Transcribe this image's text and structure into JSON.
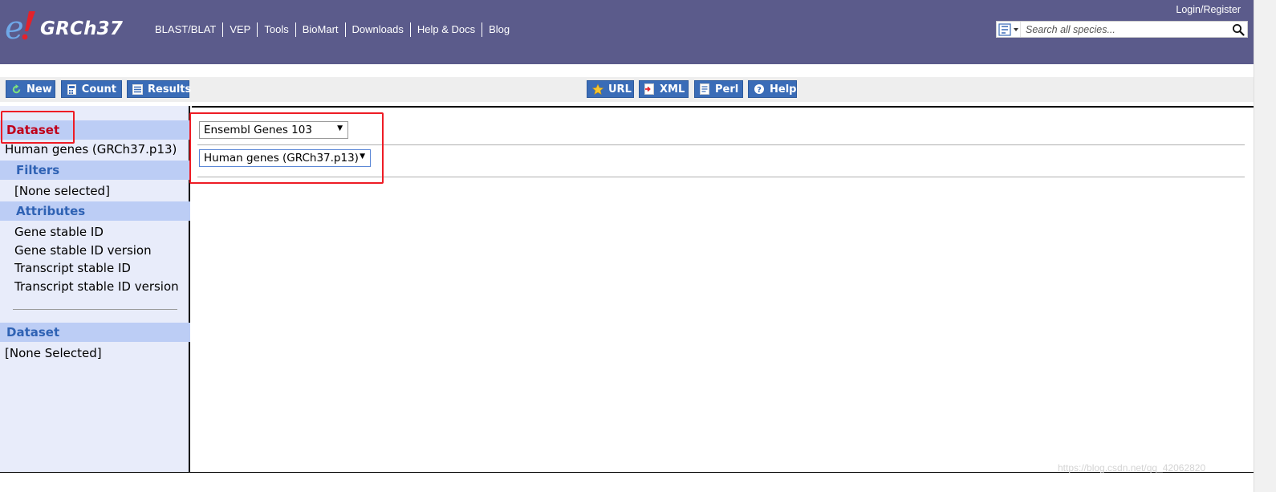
{
  "masthead": {
    "logo_text": "GRCh37",
    "nav": [
      "BLAST/BLAT",
      "VEP",
      "Tools",
      "BioMart",
      "Downloads",
      "Help & Docs",
      "Blog"
    ],
    "login": "Login/Register",
    "search": {
      "placeholder": "Search all species..."
    }
  },
  "toolbar": {
    "new": "New",
    "count": "Count",
    "results": "Results",
    "url": "URL",
    "xml": "XML",
    "perl": "Perl",
    "help": "Help"
  },
  "sidebar": {
    "dataset1": {
      "heading": "Dataset",
      "value": "Human genes (GRCh37.p13)"
    },
    "filters": {
      "heading": "Filters",
      "value": "[None selected]"
    },
    "attributes": {
      "heading": "Attributes",
      "items": [
        "Gene stable ID",
        "Gene stable ID version",
        "Transcript stable ID",
        "Transcript stable ID version"
      ]
    },
    "dataset2": {
      "heading": "Dataset",
      "value": "[None Selected]"
    }
  },
  "main": {
    "database_select": {
      "value": "Ensembl Genes 103"
    },
    "dataset_select": {
      "value": "Human genes (GRCh37.p13)"
    }
  },
  "watermark": "https://blog.csdn.net/qq_42062820",
  "colors": {
    "masthead": "#5b5b8b",
    "toolbar_button": "#3a6cb7",
    "sidebar_bg": "#e8ecfa",
    "sidebar_heading_bg": "#bccdf5",
    "heading_text": "#2f62b4",
    "active_heading_text": "#c0001a",
    "highlight_box": "#ee1c25"
  },
  "icons": {
    "logo": "ensembl-e-icon",
    "species": "species-picker-icon",
    "search": "magnifier-icon",
    "new": "refresh-icon",
    "count": "calculator-icon",
    "results": "table-icon",
    "url": "star-icon",
    "xml": "xml-file-icon",
    "perl": "script-file-icon",
    "help": "question-icon"
  }
}
